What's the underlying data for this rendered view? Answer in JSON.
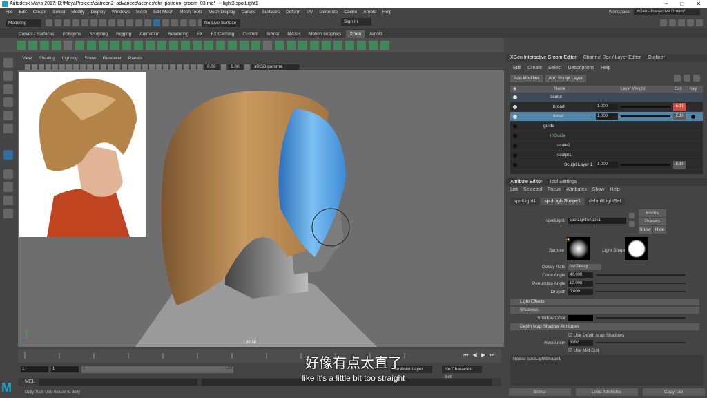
{
  "title": "Autodesk Maya 2017: D:\\MayaProjects\\patreon2_advanced\\scenes\\chr_patreon_groom_03.ma*  ---  light3|spotLight1",
  "menu": [
    "File",
    "Edit",
    "Create",
    "Select",
    "Modify",
    "Display",
    "Windows",
    "Mesh",
    "Edit Mesh",
    "Mesh Tools",
    "Mesh Display",
    "Curves",
    "Surfaces",
    "Deform",
    "UV",
    "Generate",
    "Cache",
    "Arnold",
    "Help"
  ],
  "workspace": {
    "label": "Workspace :",
    "value": "XGen - Interactive Groom*"
  },
  "status": {
    "mode": "Modeling",
    "live_surface": "No Live Surface",
    "sign_in": "Sign In"
  },
  "shelf_tabs": [
    "Curves / Surfaces",
    "Polygons",
    "Sculpting",
    "Rigging",
    "Animation",
    "Rendering",
    "FX",
    "FX Caching",
    "Custom",
    "Bifrost",
    "MASH",
    "Motion Graphics",
    "XGen",
    "Arnold"
  ],
  "shelf_active": "XGen",
  "viewport": {
    "menu": [
      "View",
      "Shading",
      "Lighting",
      "Show",
      "Renderer",
      "Panels"
    ],
    "field1": "0.00",
    "field2": "1.00",
    "colorspace": "sRGB gamma",
    "camera": "persp"
  },
  "timeline": {
    "range_start": "1",
    "range_start2": "1",
    "current": "1",
    "end": "120",
    "anim_layer": "No Anim Layer",
    "char_set": "No Character Set"
  },
  "mel_label": "MEL",
  "help_line": "Dolly Tool: Use mouse to dolly",
  "subtitle_cn": "好像有点太直了",
  "subtitle_en": "like it's a little bit too straight",
  "right_tabs": [
    "XGen Interactive Groom Editor",
    "Channel Box / Layer Editor",
    "Outliner"
  ],
  "xgen_menu": [
    "Edit",
    "Create",
    "Select",
    "Descriptions",
    "Help"
  ],
  "xgen_buttons": {
    "add_modifier": "Add Modifier",
    "add_sculpt": "Add Sculpt Layer"
  },
  "outliner": {
    "headers": {
      "name": "Name",
      "weight": "Layer Weight",
      "edit": "Edit",
      "key": "Key"
    },
    "rows": [
      {
        "name": "sculpt",
        "weight": "",
        "edit": ""
      },
      {
        "name": "broad",
        "weight": "1.000",
        "edit": "Edit"
      },
      {
        "name": "detail",
        "weight": "1.000",
        "edit": "Edit"
      },
      {
        "name": "guide",
        "weight": "",
        "edit": ""
      },
      {
        "name": "inGuide",
        "weight": "",
        "edit": ""
      },
      {
        "name": "scale2",
        "weight": "",
        "edit": ""
      },
      {
        "name": "sculpt1",
        "weight": "",
        "edit": ""
      },
      {
        "name": "Sculpt Layer 1",
        "weight": "1.000",
        "edit": "Edit"
      }
    ]
  },
  "attr_tabs": [
    "Attribute Editor",
    "Tool Settings"
  ],
  "attr_menu": [
    "List",
    "Selected",
    "Focus",
    "Attributes",
    "Show",
    "Help"
  ],
  "node_tabs": [
    "spotLight1",
    "spotLightShape1",
    "defaultLightSet"
  ],
  "attr": {
    "spot_label": "spotLight:",
    "spot_value": "spotLightShape1",
    "focus": "Focus",
    "presets": "Presets",
    "show": "Show",
    "hide": "Hide",
    "sample": "Sample",
    "light_shape": "Light Shape",
    "decay_label": "Decay Rate",
    "decay_value": "No Decay",
    "cone_label": "Cone Angle",
    "cone_value": "40.000",
    "penumbra_label": "Penumbra Angle",
    "penumbra_value": "10.000",
    "dropoff_label": "Dropoff",
    "dropoff_value": "0.000",
    "sec_light_effects": "Light Effects",
    "sec_shadows": "Shadows",
    "shadow_color": "Shadow Color",
    "sec_depth": "Depth Map Shadow Attributes",
    "use_depth": "Use Depth Map Shadows",
    "resolution_label": "Resolution",
    "resolution_value": "8192",
    "use_mid": "Use Mid Dist"
  },
  "notes": "Notes: spotLightShape1",
  "bottom": {
    "select": "Select",
    "load": "Load Attributes",
    "copy": "Copy Tab"
  },
  "colors": {
    "hair": "#b58a56",
    "hair_blue": "#4e9fe0",
    "accent": "#5285a6",
    "edit_red": "#e0463a"
  }
}
